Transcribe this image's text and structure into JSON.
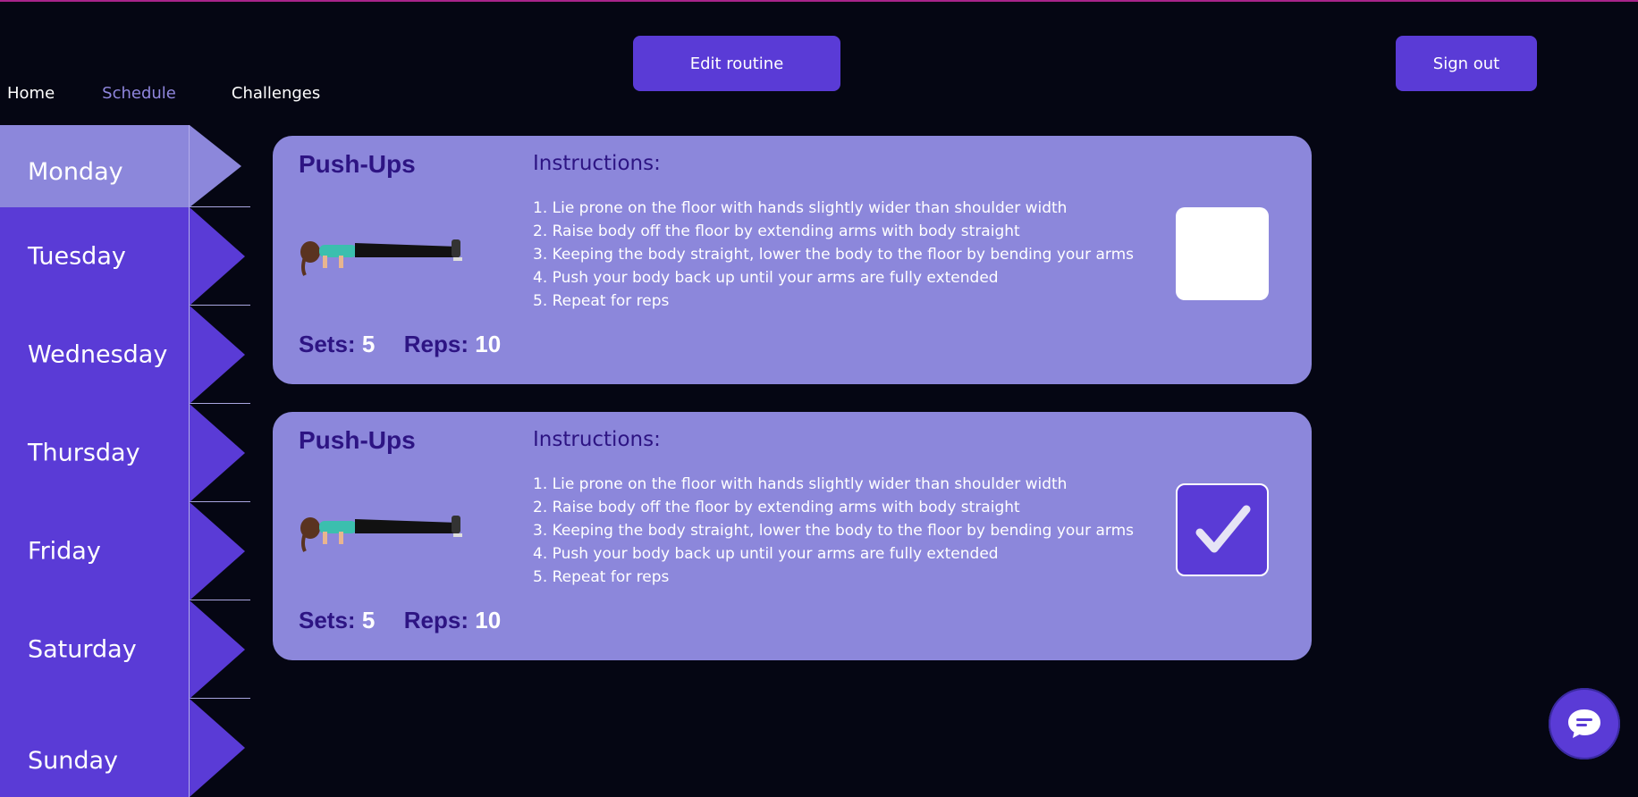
{
  "nav": {
    "home": "Home",
    "schedule": "Schedule",
    "challenges": "Challenges"
  },
  "header": {
    "edit_label": "Edit routine",
    "signout_label": "Sign out"
  },
  "days": [
    "Monday",
    "Tuesday",
    "Wednesday",
    "Thursday",
    "Friday",
    "Saturday",
    "Sunday"
  ],
  "active_day": "Monday",
  "instructions_heading": "Instructions:",
  "sets_label": "Sets:",
  "reps_label": "Reps:",
  "exercises": [
    {
      "title": "Push-Ups",
      "sets": "5",
      "reps": "10",
      "completed": false,
      "steps": [
        "1. Lie prone on the floor with hands slightly wider than shoulder width",
        "2. Raise body off the floor by extending arms with body straight",
        "3. Keeping the body straight, lower the body to the floor by bending your arms",
        "4. Push your body back up until your arms are fully extended",
        "5. Repeat for reps"
      ]
    },
    {
      "title": "Push-Ups",
      "sets": "5",
      "reps": "10",
      "completed": true,
      "steps": [
        "1. Lie prone on the floor with hands slightly wider than shoulder width",
        "2. Raise body off the floor by extending arms with body straight",
        "3. Keeping the body straight, lower the body to the floor by bending your arms",
        "4. Push your body back up until your arms are fully extended",
        "5. Repeat for reps"
      ]
    }
  ],
  "colors": {
    "accent": "#5a3bd6",
    "card": "#8c87db",
    "title": "#2d1483",
    "background": "#050613"
  },
  "icons": {
    "check": "checkmark-icon",
    "chat": "chat-icon",
    "exercise": "pushup-figure-icon"
  }
}
